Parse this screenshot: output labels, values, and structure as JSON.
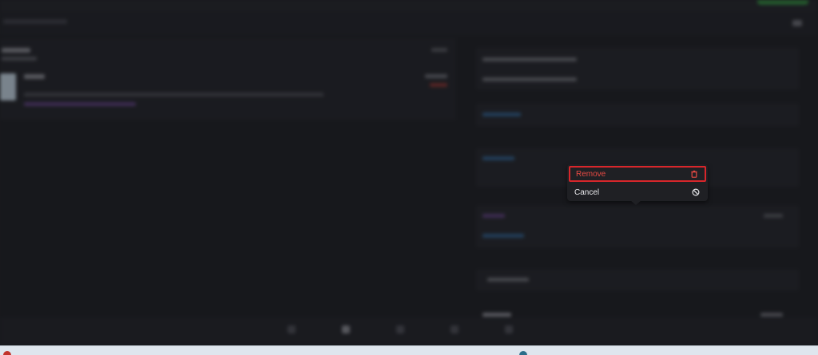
{
  "menu": {
    "remove_label": "Remove",
    "cancel_label": "Cancel",
    "remove_icon": "trash-icon",
    "cancel_icon": "cancel-icon",
    "remove_color": "#e84a43",
    "highlight_border": "#d8262b"
  }
}
